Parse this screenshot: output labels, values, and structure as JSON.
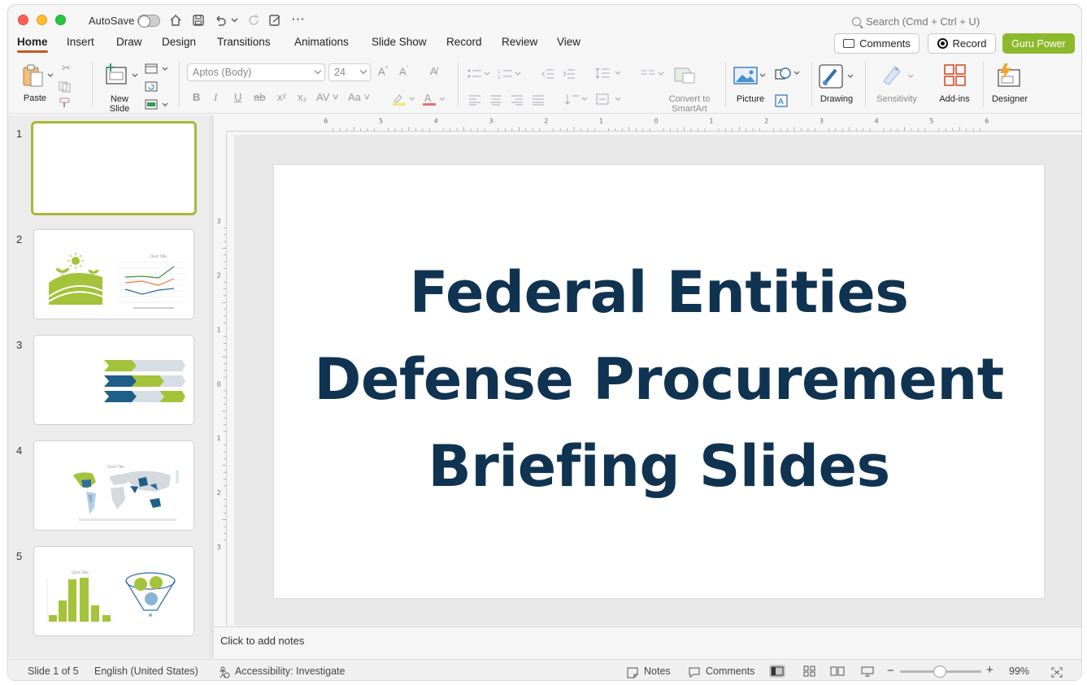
{
  "app": {
    "autosave_label": "AutoSave",
    "search_placeholder": "Search (Cmd + Ctrl + U)"
  },
  "tabs": [
    "Home",
    "Insert",
    "Draw",
    "Design",
    "Transitions",
    "Animations",
    "Slide Show",
    "Record",
    "Review",
    "View"
  ],
  "header_buttons": {
    "comments": "Comments",
    "record": "Record",
    "addin": "Guru Power"
  },
  "ribbon": {
    "paste": "Paste",
    "new_slide_1": "New",
    "new_slide_2": "Slide",
    "font_name": "Aptos (Body)",
    "font_size": "24",
    "convert_1": "Convert to",
    "convert_2": "SmartArt",
    "picture": "Picture",
    "drawing": "Drawing",
    "sensitivity": "Sensitivity",
    "addins": "Add-ins",
    "designer": "Designer"
  },
  "slides": [
    "1",
    "2",
    "3",
    "4",
    "5"
  ],
  "slide": {
    "title_lines": [
      "Federal Entities",
      "Defense Procurement",
      "Briefing Slides"
    ]
  },
  "ruler": {
    "h_ticks": [
      "6",
      "5",
      "4",
      "3",
      "2",
      "1",
      "0",
      "1",
      "2",
      "3",
      "4",
      "5",
      "6"
    ],
    "v_ticks": [
      "3",
      "2",
      "1",
      "0",
      "1",
      "2",
      "3"
    ]
  },
  "notes_placeholder": "Click to add notes",
  "status": {
    "slide_of": "Slide 1 of 5",
    "language": "English (United States)",
    "accessibility": "Accessibility: Investigate",
    "notes": "Notes",
    "comments": "Comments",
    "zoom": "99%"
  },
  "colors": {
    "accent_tab": "#c55a1c",
    "addin_green": "#8db82c",
    "title_navy": "#0f3350",
    "selection": "#a8b836"
  }
}
